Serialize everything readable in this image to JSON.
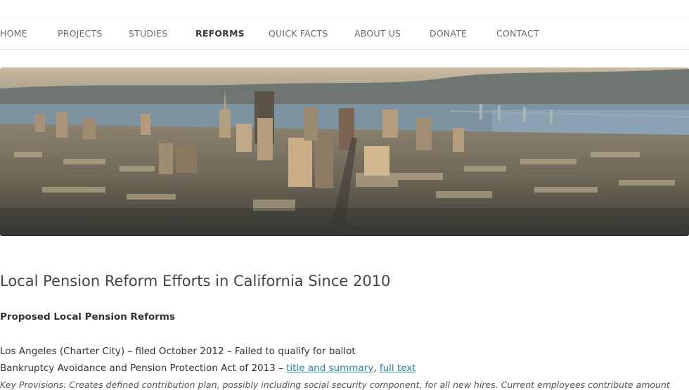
{
  "nav": {
    "items": [
      {
        "label": "HOME"
      },
      {
        "label": "PROJECTS"
      },
      {
        "label": "STUDIES"
      },
      {
        "label": "REFORMS",
        "active": true
      },
      {
        "label": "QUICK FACTS"
      },
      {
        "label": "ABOUT US"
      },
      {
        "label": "DONATE"
      },
      {
        "label": "CONTACT"
      }
    ]
  },
  "hero": {
    "description_icon": "city-skyline-image"
  },
  "content": {
    "title": "Local Pension Reform Efforts in California Since 2010",
    "subhead": "Proposed Local Pension Reforms",
    "line1": "Los Angeles (Charter City) – filed October 2012 – Failed to qualify for ballot",
    "line2_text": "Bankruptcy Avoidance and Pension Protection Act of 2013 – ",
    "line2_link1": "title and summary",
    "line2_sep": ", ",
    "line2_link2": "full text",
    "line3": "Key Provisions: Creates defined contribution plan, possibly including social security component, for all new hires. Current employees contribute amount"
  },
  "colors": {
    "link": "#2a7fa6",
    "nav_text": "#6b6b6b",
    "nav_active": "#3a3a3a"
  }
}
